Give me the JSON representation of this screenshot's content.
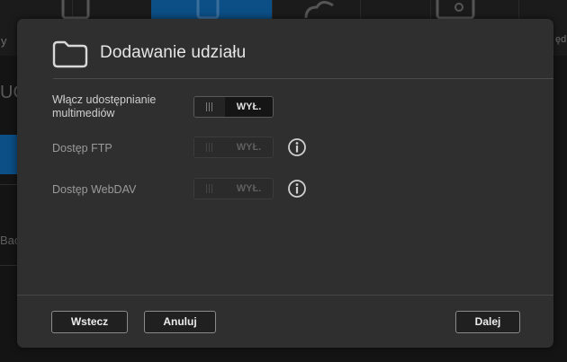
{
  "background": {
    "left_nav_fragment": "y",
    "left_heading_fragment": "UC",
    "left_row_fragment": "Bac",
    "right_nav_fragment": "ęd"
  },
  "dialog": {
    "title": "Dodawanie udziału",
    "icon": "folder-icon",
    "rows": [
      {
        "label_line1": "Włącz udostępnianie",
        "label_line2": "multimediów",
        "toggle_state": "WYŁ.",
        "enabled": true
      },
      {
        "label": "Dostęp FTP",
        "toggle_state": "WYŁ.",
        "enabled": false,
        "info_icon": "info-icon"
      },
      {
        "label": "Dostęp WebDAV",
        "toggle_state": "WYŁ.",
        "enabled": false,
        "info_icon": "info-icon"
      }
    ],
    "buttons": {
      "back": "Wstecz",
      "cancel": "Anuluj",
      "next": "Dalej"
    }
  },
  "colors": {
    "modal_bg": "#2f2f2f",
    "page_bg": "#141414",
    "accent_blue": "#0b4f86"
  }
}
